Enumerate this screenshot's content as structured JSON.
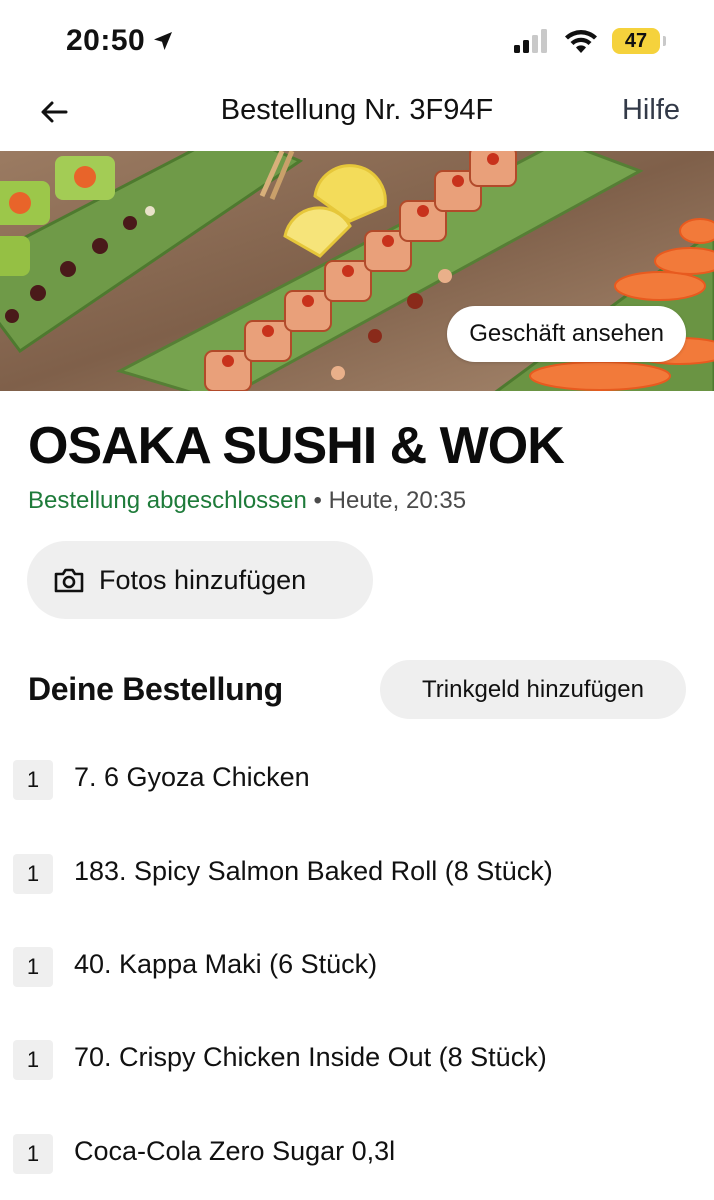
{
  "status_bar": {
    "time": "20:50",
    "battery_level": "47",
    "signal_bars_active": 2,
    "signal_bars_total": 4
  },
  "nav": {
    "title": "Bestellung Nr. 3F94F",
    "help_label": "Hilfe"
  },
  "hero": {
    "view_store_label": "Geschäft ansehen"
  },
  "store": {
    "name": "OSAKA SUSHI & WOK",
    "status": "Bestellung abgeschlossen",
    "separator": " • ",
    "time": "Heute, 20:35"
  },
  "actions": {
    "add_photos_label": "Fotos hinzufügen"
  },
  "order": {
    "section_title": "Deine Bestellung",
    "tip_label": "Trinkgeld hinzufügen",
    "items": [
      {
        "qty": "1",
        "name": "7. 6 Gyoza Chicken"
      },
      {
        "qty": "1",
        "name": "183. Spicy Salmon Baked Roll (8 Stück)"
      },
      {
        "qty": "1",
        "name": "40. Kappa Maki (6 Stück)"
      },
      {
        "qty": "1",
        "name": "70. Crispy Chicken Inside Out (8 Stück)"
      },
      {
        "qty": "1",
        "name": "Coca-Cola Zero Sugar 0,3l"
      }
    ]
  },
  "colors": {
    "status_green": "#1e7b3a",
    "battery_yellow": "#f5d23c",
    "pill_gray": "#efefef"
  },
  "icons": {
    "back": "arrow-left-icon",
    "location": "location-arrow-icon",
    "signal": "cellular-signal-icon",
    "wifi": "wifi-icon",
    "camera": "camera-icon"
  }
}
